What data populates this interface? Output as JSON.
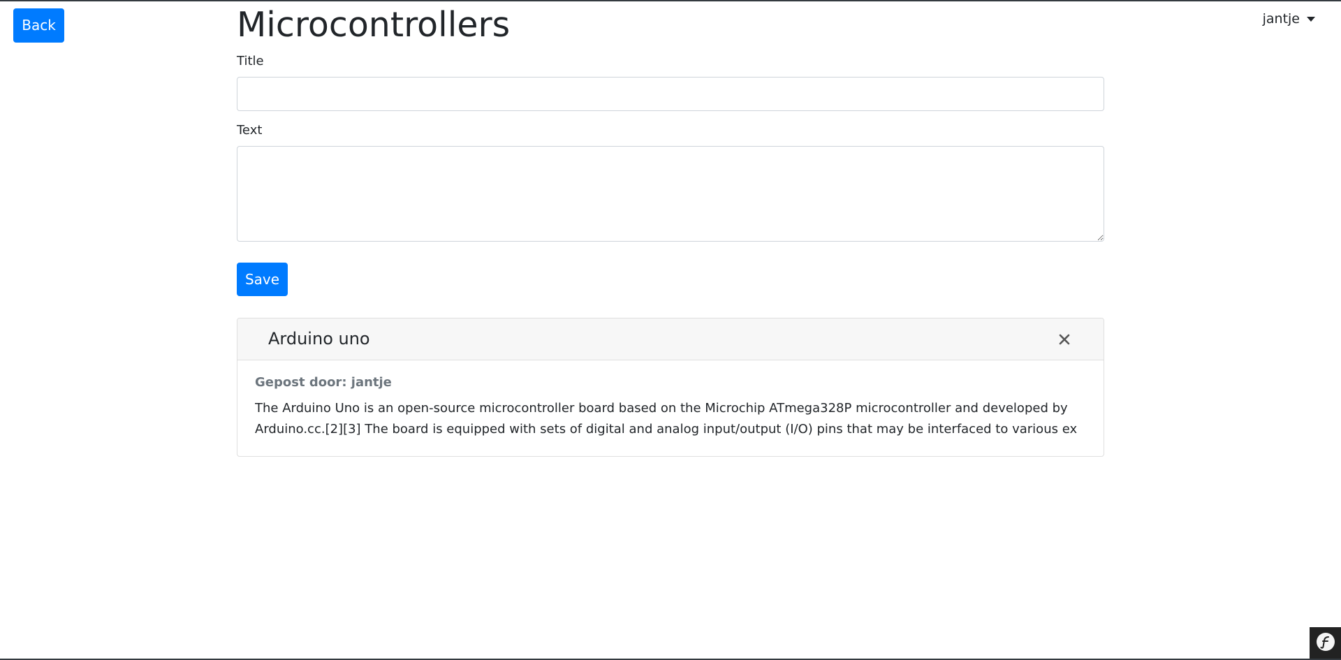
{
  "nav": {
    "back_label": "Back",
    "user_name": "jantje"
  },
  "page": {
    "title": "Microcontrollers"
  },
  "form": {
    "title_label": "Title",
    "title_value": "",
    "text_label": "Text",
    "text_value": "",
    "save_label": "Save"
  },
  "posts": [
    {
      "title": "Arduino uno",
      "author_line": "Gepost door: jantje",
      "text_line_1": "The Arduino Uno is an open-source microcontroller board based on the Microchip ATmega328P microcontroller and developed by",
      "text_line_2": "Arduino.cc.[2][3] The board is equipped with sets of digital and analog input/output (I/O) pins that may be interfaced to various ex"
    }
  ],
  "colors": {
    "primary": "#007bff",
    "card_header_bg": "#f7f7f7",
    "muted_text": "#6c757d"
  },
  "icons": {
    "close": "close-icon",
    "caret": "caret-down-icon",
    "toolbar": "symfony-logo-icon"
  }
}
